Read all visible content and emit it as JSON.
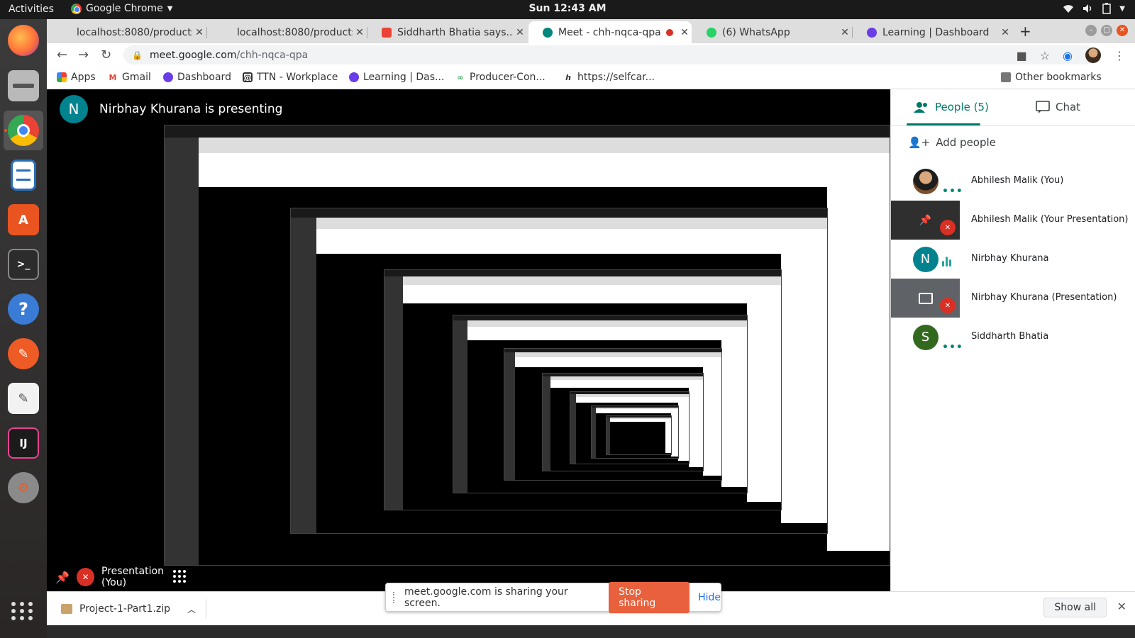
{
  "os": {
    "activities": "Activities",
    "app_menu": "Google Chrome",
    "clock": "Sun 12:43 AM"
  },
  "dock": {
    "items": [
      {
        "name": "firefox",
        "color": "#ff7139"
      },
      {
        "name": "files",
        "color": "#b9b9b9"
      },
      {
        "name": "chrome",
        "color": "#4285f4"
      },
      {
        "name": "writer",
        "color": "#2a6fbb"
      },
      {
        "name": "software",
        "color": "#e95420"
      },
      {
        "name": "terminal",
        "color": "#2c2c2c"
      },
      {
        "name": "help",
        "color": "#3a7bd5"
      },
      {
        "name": "postman",
        "color": "#ef5b25"
      },
      {
        "name": "text-editor",
        "color": "#f2f2f2"
      },
      {
        "name": "intellij",
        "color": "#1b1b1b"
      },
      {
        "name": "settings",
        "color": "#e25e2c"
      }
    ]
  },
  "tabs": [
    {
      "title": "localhost:8080/products",
      "favicon_color": "#dedede"
    },
    {
      "title": "localhost:8080/products",
      "favicon_color": "#dedede"
    },
    {
      "title": "Siddharth Bhatia says...",
      "favicon_color": "#ea4335"
    },
    {
      "title": "Meet - chh-nqca-qpa",
      "favicon_color": "#00897b",
      "active": true
    },
    {
      "title": "(6) WhatsApp",
      "favicon_color": "#25d366"
    },
    {
      "title": "Learning | Dashboard",
      "favicon_color": "#6a3de8"
    }
  ],
  "omnibox": {
    "host": "meet.google.com",
    "path": "/chh-nqca-qpa"
  },
  "bookmarks": [
    {
      "label": "Apps",
      "icon": "apps-icon",
      "color": "#ea4335"
    },
    {
      "label": "Gmail",
      "icon": "gmail-icon",
      "color": "#ea4335"
    },
    {
      "label": "Dashboard",
      "icon": "dashboard-icon",
      "color": "#6a3de8"
    },
    {
      "label": "TTN - Workplace",
      "icon": "workplace-icon",
      "color": "#333333"
    },
    {
      "label": "Learning | Das...",
      "icon": "learning-icon",
      "color": "#6a3de8"
    },
    {
      "label": "Producer-Con...",
      "icon": "producer-icon",
      "color": "#34a853"
    },
    {
      "label": "https://selfcar...",
      "icon": "selfcare-icon",
      "color": "#333333"
    }
  ],
  "other_bookmarks": "Other bookmarks",
  "meet": {
    "presenter_initial": "N",
    "presenting_text": "Nirbhay Khurana is presenting",
    "self_presentation_label": "Presentation (You)",
    "accent": "#00796b"
  },
  "side_panel": {
    "people_tab": "People (5)",
    "chat_tab": "Chat",
    "add_people": "Add people",
    "participants": [
      {
        "name": "Abhilesh Malik (You)",
        "kind": "photo"
      },
      {
        "name": "Abhilesh Malik (Your Presentation)",
        "kind": "presentation-self"
      },
      {
        "name": "Nirbhay Khurana",
        "kind": "initial",
        "initial": "N",
        "color": "#00838f"
      },
      {
        "name": "Nirbhay Khurana (Presentation)",
        "kind": "presentation"
      },
      {
        "name": "Siddharth Bhatia",
        "kind": "initial",
        "initial": "S",
        "color": "#33691e"
      }
    ]
  },
  "share_banner": {
    "message": "meet.google.com is sharing your screen.",
    "stop": "Stop sharing",
    "hide": "Hide"
  },
  "downloads": {
    "file": "Project-1-Part1.zip",
    "show_all": "Show all"
  }
}
